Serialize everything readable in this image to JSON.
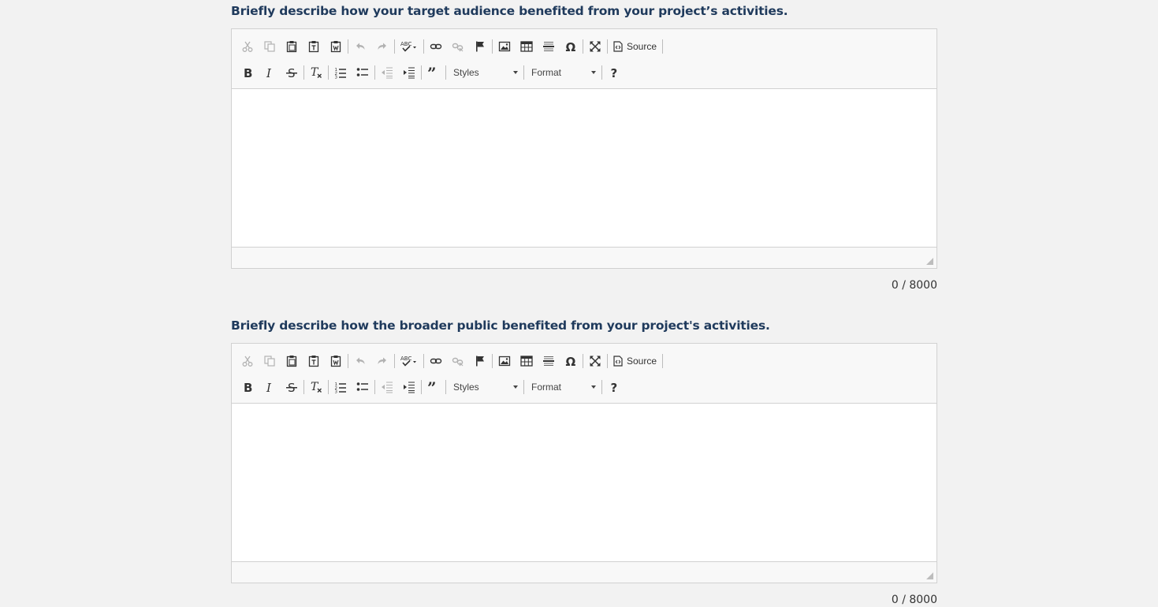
{
  "questions": [
    {
      "label": "Briefly describe how your target audience benefited from your project’s activities.",
      "counter": "0 / 8000",
      "content": ""
    },
    {
      "label": "Briefly describe how the broader public benefited from your project's activities.",
      "counter": "0 / 8000",
      "content": ""
    }
  ],
  "toolbar": {
    "source_label": "Source",
    "styles_label": "Styles",
    "format_label": "Format",
    "help_label": "?",
    "icons": [
      "cut-icon",
      "copy-icon",
      "paste-icon",
      "paste-text-icon",
      "paste-word-icon",
      "undo-icon",
      "redo-icon",
      "spellcheck-icon",
      "link-icon",
      "unlink-icon",
      "anchor-icon",
      "image-icon",
      "table-icon",
      "horizontal-line-icon",
      "special-char-icon",
      "maximize-icon",
      "source-icon",
      "bold-icon",
      "italic-icon",
      "strike-icon",
      "remove-format-icon",
      "numbered-list-icon",
      "bulleted-list-icon",
      "outdent-icon",
      "indent-icon",
      "blockquote-icon",
      "help-icon"
    ]
  }
}
